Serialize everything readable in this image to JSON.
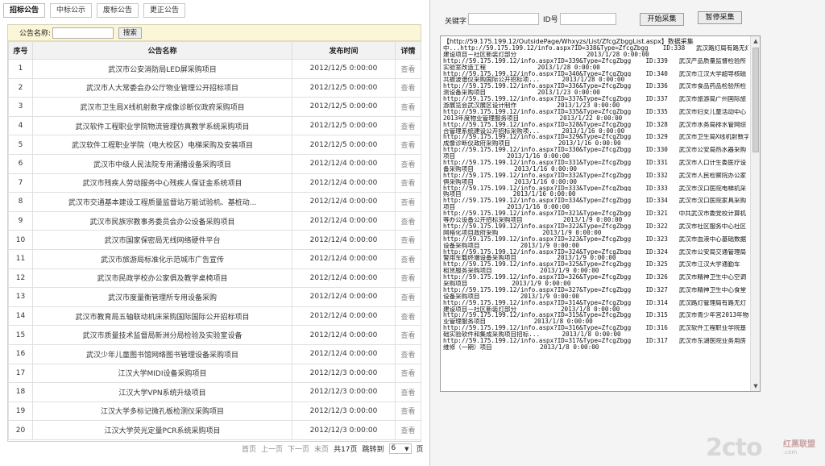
{
  "left": {
    "tabs": [
      "招标公告",
      "中标公示",
      "废标公告",
      "更正公告"
    ],
    "search": {
      "label": "公告名称:",
      "value": "",
      "button": "搜索"
    },
    "columns": [
      "序号",
      "公告名称",
      "发布时间",
      "详情"
    ],
    "rows": [
      {
        "no": "1",
        "name": "武汉市公安消防局LED屏采购项目",
        "date": "2012/12/5 0:00:00",
        "action": "查看"
      },
      {
        "no": "2",
        "name": "武汉市人大常委会办公厅物业管理公开招标项目",
        "date": "2012/12/5 0:00:00",
        "action": "查看"
      },
      {
        "no": "3",
        "name": "武汉市卫生局X线机射数字成像诊断仪政府采购项目",
        "date": "2012/12/5 0:00:00",
        "action": "查看"
      },
      {
        "no": "4",
        "name": "武汉软件工程职业学院物流管理仿真教学系统采购项目",
        "date": "2012/12/5 0:00:00",
        "action": "查看"
      },
      {
        "no": "5",
        "name": "武汉软件工程职业学院（电大校区）电梯采购及安装项目",
        "date": "2012/12/5 0:00:00",
        "action": "查看"
      },
      {
        "no": "6",
        "name": "武汉市中级人民法院专用涌播设备采购项目",
        "date": "2012/12/4 0:00:00",
        "action": "查看"
      },
      {
        "no": "7",
        "name": "武汉市残疾人劳动服务中心残疾人保证金系统项目",
        "date": "2012/12/4 0:00:00",
        "action": "查看"
      },
      {
        "no": "8",
        "name": "武汉市交通基本建设工程质量监督站万能试验机、基桩动...",
        "date": "2012/12/4 0:00:00",
        "action": "查看"
      },
      {
        "no": "9",
        "name": "武汉市民族宗教事务委员会办公设备采购项目",
        "date": "2012/12/4 0:00:00",
        "action": "查看"
      },
      {
        "no": "10",
        "name": "武汉市国家保密局无线网络硬件平台",
        "date": "2012/12/4 0:00:00",
        "action": "查看"
      },
      {
        "no": "11",
        "name": "武汉市旅游局标准化示范城市广告宣传",
        "date": "2012/12/4 0:00:00",
        "action": "查看"
      },
      {
        "no": "12",
        "name": "武汉市民政学校办公家俱及教学桌椅项目",
        "date": "2012/12/4 0:00:00",
        "action": "查看"
      },
      {
        "no": "13",
        "name": "武汉市度量衡管理所专用设备采购",
        "date": "2012/12/4 0:00:00",
        "action": "查看"
      },
      {
        "no": "14",
        "name": "武汉市教育局五轴联动机床采购国际国际公开招标项目",
        "date": "2012/12/4 0:00:00",
        "action": "查看"
      },
      {
        "no": "15",
        "name": "武汉市质量技术监督局新洲分局检验及实验室设备",
        "date": "2012/12/4 0:00:00",
        "action": "查看"
      },
      {
        "no": "16",
        "name": "武汉少年儿童图书馆网络图书管理设备采购项目",
        "date": "2012/12/4 0:00:00",
        "action": "查看"
      },
      {
        "no": "17",
        "name": "江汉大学MIDI设备采购项目",
        "date": "2012/12/3 0:00:00",
        "action": "查看"
      },
      {
        "no": "18",
        "name": "江汉大学VPN系统升级项目",
        "date": "2012/12/3 0:00:00",
        "action": "查看"
      },
      {
        "no": "19",
        "name": "江汉大学多标记微孔板检测仪采购项目",
        "date": "2012/12/3 0:00:00",
        "action": "查看"
      },
      {
        "no": "20",
        "name": "江汉大学荧光定量PCR系统采购项目",
        "date": "2012/12/3 0:00:00",
        "action": "查看"
      }
    ],
    "pager": {
      "first": "首页",
      "prev": "上一页",
      "next": "下一页",
      "last": "末页",
      "total": "共17页",
      "jump_label": "跳转到",
      "page_value": "6",
      "page_suffix": "页"
    }
  },
  "right": {
    "keyword_label": "关键字",
    "keyword_value": "",
    "id_label": "ID号",
    "id_value": "",
    "start_button": "开始采集",
    "stop_button": "暂停采集",
    "log_lines": [
      "【http://59.175.199.12/OutsidePage/Whxyzs/List/ZfcgZbggList.aspx】数据采集",
      "中...http://59.175.199.12/info.aspx?ID=338&Type=ZfcgZbgg    ID:338   武汉路灯局有路无灯",
      "建设项目－社区新装灯部分                   2013/1/28 0:00:00",
      "http://59.175.199.12/info.aspx?ID=339&Type=ZfcgZbgg    ID:339   武汉产品质量监督检验所",
      "实验室改造工程              2013/1/28 0:00:00",
      "http://59.175.199.12/info.aspx?ID=340&Type=ZfcgZbgg    ID:340   武汉市江汉大学超导核磁",
      "共振波谱仪采购国际公开招标项...      2013/1/28 0:00:00",
      "http://59.175.199.12/info.aspx?ID=336&Type=ZfcgZbgg    ID:336   武汉市食品药品检验所检",
      "测设备采购项目              2013/1/23 0:00:00",
      "http://59.175.199.12/info.aspx?ID=337&Type=ZfcgZbgg    ID:337   武汉市旅游局广州国际旅",
      "游展览会武汉展区设计制作           2013/1/23 0:00:00",
      "http://59.175.199.12/info.aspx?ID=335&Type=ZfcgZbgg    ID:335   武汉市妇女儿童活动中心",
      "2013年度物业管理服务项目           2013/1/22 0:00:00",
      "http://59.175.199.12/info.aspx?ID=328&Type=ZfcgZbgg    ID:328   武汉市水务局排水管网综",
      "合管理系统建设公开招标采购项...      2013/1/16 0:00:00",
      "http://59.175.199.12/info.aspx?ID=329&Type=ZfcgZbgg    ID:329   武汉市卫生局X线机射数字",
      "成像诊断仪政府采购项目             2013/1/16 0:00:00",
      "http://59.175.199.12/info.aspx?ID=330&Type=ZfcgZbgg    ID:330   武汉市公安局热水器采购",
      "项目              2013/1/16 0:00:00",
      "http://59.175.199.12/info.aspx?ID=331&Type=ZfcgZbgg    ID:331   武汉市人口计生委医疗设",
      "备采购项目           2013/1/16 0:00:00",
      "http://59.175.199.12/info.aspx?ID=332&Type=ZfcgZbgg    ID:332   武汉市人民检察院办公家",
      "俱采购项目           2013/1/16 0:00:00",
      "http://59.175.199.12/info.aspx?ID=333&Type=ZfcgZbgg    ID:333   武汉市汉口医院电梯机采",
      "购项目              2013/1/16 0:00:00",
      "http://59.175.199.12/info.aspx?ID=334&Type=ZfcgZbgg    ID:334   武汉市汉口医院家具采购",
      "项目              2013/1/16 0:00:00",
      "http://59.175.199.12/info.aspx?ID=321&Type=ZfcgZbgg    ID:321   中共武汉市委党校计算机",
      "等办公设备公开招标采购项目           2013/1/9 0:00:00",
      "http://59.175.199.12/info.aspx?ID=322&Type=ZfcgZbgg    ID:322   武汉市社区服务中心社区",
      "网格化项目政府采购            2013/1/9 0:00:00",
      "http://59.175.199.12/info.aspx?ID=323&Type=ZfcgZbgg    ID:323   武汉市血液中心基础数据",
      "设备采购项目           2013/1/9 0:00:00",
      "http://59.175.199.12/info.aspx?ID=324&Type=ZfcgZbgg    ID:324   武汉市公安局交通管理局",
      "警用车载终端设备采购项目           2013/1/9 0:00:00",
      "http://59.175.199.12/info.aspx?ID=325&Type=ZfcgZbgg    ID:325   武汉市江汉大学通勤车",
      "租赁服务采购项目             2013/1/9 0:00:00",
      "http://59.175.199.12/info.aspx?ID=326&Type=ZfcgZbgg    ID:326   武汉市精神卫生中心空调",
      "采购项目            2013/1/9 0:00:00",
      "http://59.175.199.12/info.aspx?ID=327&Type=ZfcgZbgg    ID:327   武汉市精神卫生中心食堂",
      "设备采购项目           2013/1/9 0:00:00",
      "http://59.175.199.12/info.aspx?ID=314&Type=ZfcgZbgg    ID:314   武汉路灯管理局有路无灯",
      "建设项目－社区新装灯部分            2013/1/8 0:00:00",
      "http://59.175.199.12/info.aspx?ID=315&Type=ZfcgZbgg    ID:315   武汉市青少年宫2013年物",
      "业管理服务项目             2013/1/8 0:00:00",
      "http://59.175.199.12/info.aspx?ID=316&Type=ZfcgZbgg    ID:316   武汉软件工程职业学院基",
      "础实验软件和集成采购项目招标...      2013/1/8 0:00:00",
      "http://59.175.199.12/info.aspx?ID=317&Type=ZfcgZbgg    ID:317   武汉市东湖医院业务用房",
      "维修（一期）项目             2013/1/8 0:00:00"
    ]
  },
  "watermark": {
    "number": "2cto",
    "brand": "红黑联盟",
    "domain": ".com"
  }
}
